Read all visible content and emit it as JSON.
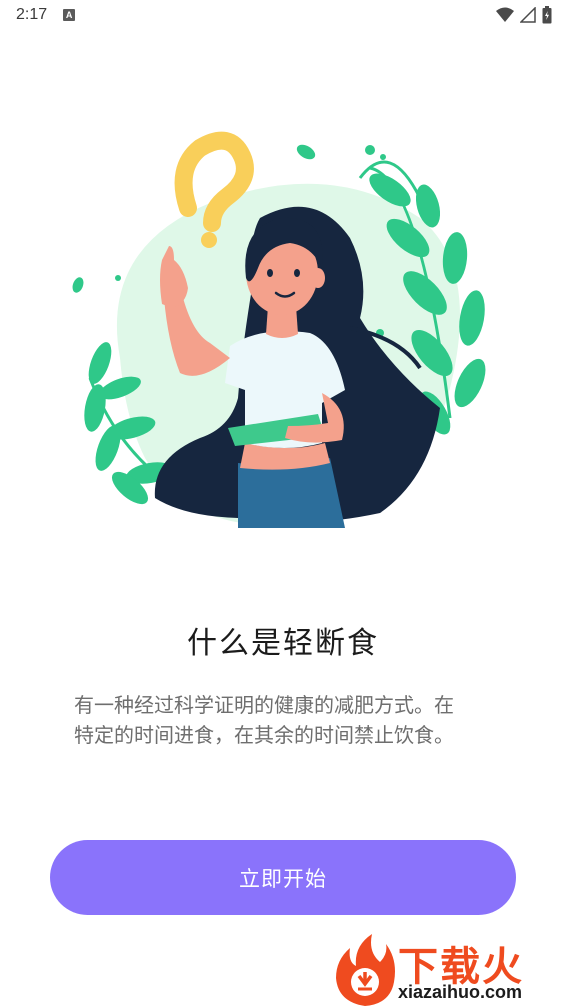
{
  "status_bar": {
    "time": "2:17",
    "notification_icon": "a-icon",
    "icons": [
      "wifi-icon",
      "signal-icon",
      "battery-icon"
    ]
  },
  "onboarding": {
    "title": "什么是轻断食",
    "description_lines": [
      "有一种经过科学证明的健康的减肥方式。在",
      "特定的时间进食，在其余的时间禁止饮食。"
    ],
    "start_button_label": "立即开始"
  },
  "watermark": {
    "brand": "下载火",
    "url": "xiazaihuo.com"
  },
  "colors": {
    "button": "#8a73fb",
    "leaf_green": "#2fc889",
    "blob_green": "#dff8e8",
    "question_mark": "#f9cf5a",
    "hair": "#16263f",
    "watermark_orange": "#ef4b1f"
  }
}
